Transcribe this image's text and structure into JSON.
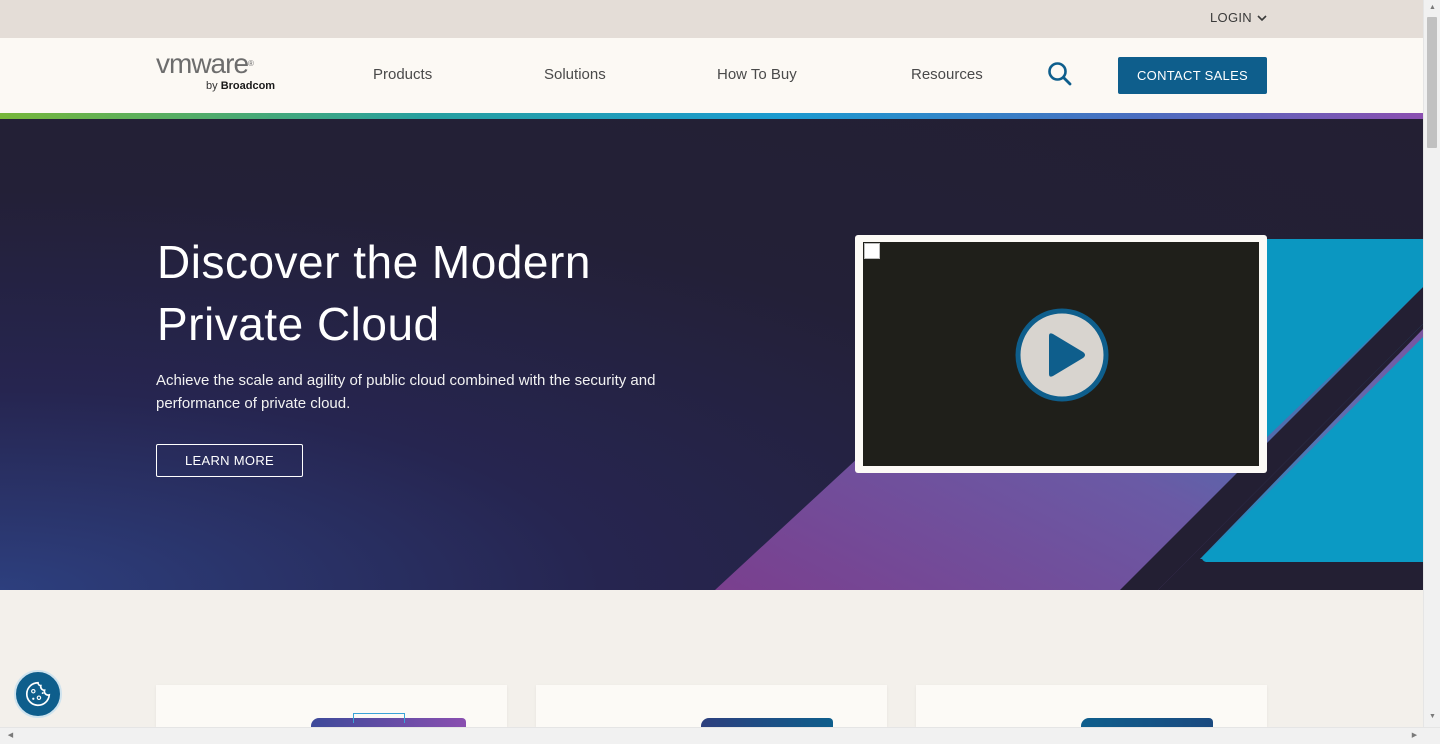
{
  "utility": {
    "login_label": "LOGIN"
  },
  "logo": {
    "main": "vmware",
    "by": "by",
    "brand": "Broadcom"
  },
  "nav": {
    "items": [
      {
        "label": "Products"
      },
      {
        "label": "Solutions"
      },
      {
        "label": "How To Buy"
      },
      {
        "label": "Resources"
      }
    ],
    "search_icon": "search-icon",
    "contact_label": "CONTACT SALES"
  },
  "hero": {
    "title_line1": "Discover the Modern",
    "title_line2": "Private Cloud",
    "description": "Achieve the scale and agility of public cloud combined with the security and performance of private cloud.",
    "cta_label": "LEARN MORE",
    "play_icon": "play-icon"
  },
  "colors": {
    "accent": "#0e5e8c",
    "hero_bg": "#231f33",
    "page_bg": "#f3f0eb",
    "cyan": "#0b97c1"
  },
  "cookie_icon": "cookie-icon"
}
